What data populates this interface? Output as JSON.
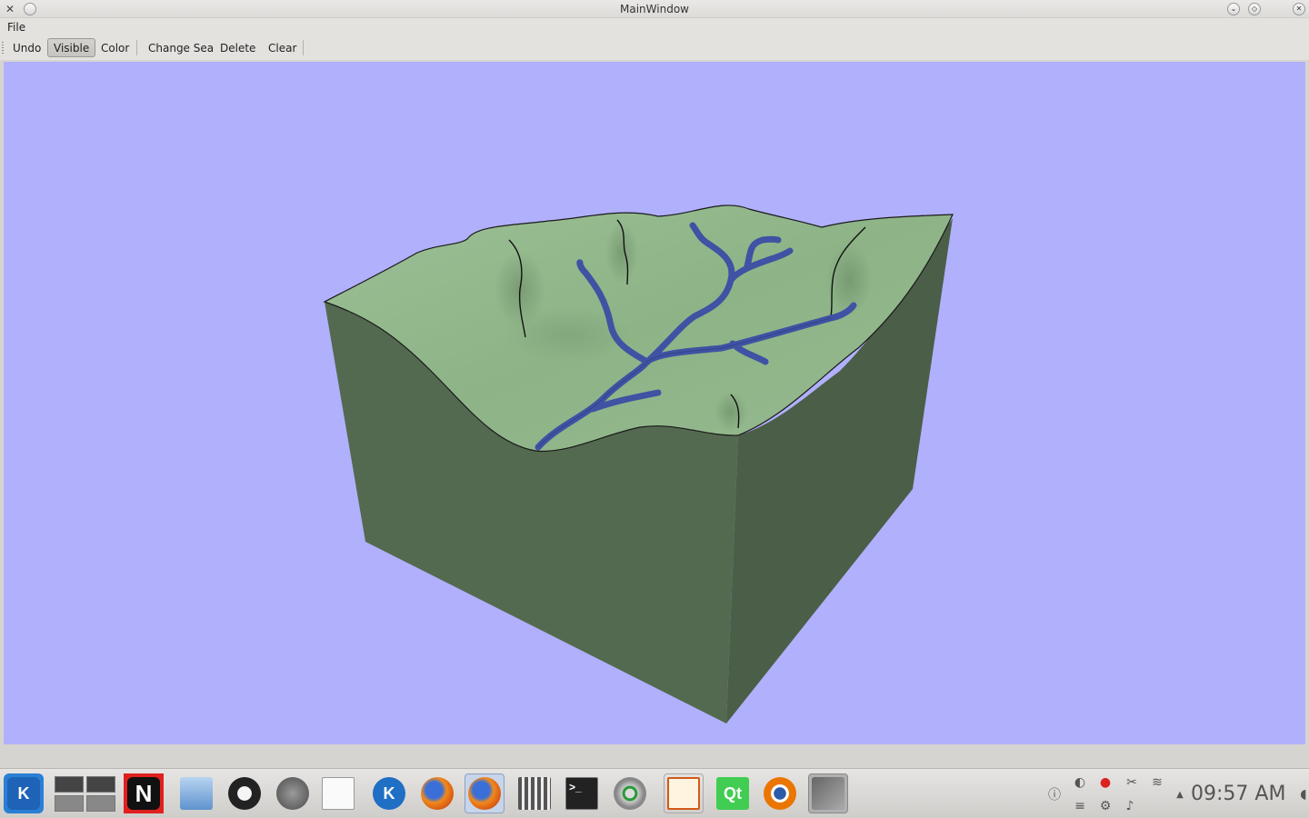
{
  "window": {
    "title": "MainWindow"
  },
  "menubar": {
    "file_label": "File"
  },
  "toolbar": {
    "undo_label": "Undo",
    "visible_label": "Visible",
    "color_label": "Color",
    "change_sea_label": "Change Sea",
    "delete_label": "Delete",
    "clear_label": "Clear"
  },
  "viewport": {
    "background_color": "#b1b0fc",
    "terrain_top_color": "#8fb58a",
    "terrain_side_color": "#536a4f",
    "river_color": "#3f52a3"
  },
  "taskbar": {
    "apps": [
      {
        "icon": "kde-menu-icon",
        "glyph": "K"
      },
      {
        "icon": "pager-icon",
        "glyph": ""
      },
      {
        "icon": "netflix-icon",
        "glyph": "N"
      },
      {
        "icon": "file-manager-icon",
        "glyph": ""
      },
      {
        "icon": "tux-icon",
        "glyph": ""
      },
      {
        "icon": "spotify-icon",
        "glyph": ""
      },
      {
        "icon": "text-editor-icon",
        "glyph": ""
      },
      {
        "icon": "kde-app-icon",
        "glyph": "K"
      },
      {
        "icon": "firefox-icon",
        "glyph": ""
      },
      {
        "icon": "firefox-active-icon",
        "glyph": ""
      },
      {
        "icon": "calculator-icon",
        "glyph": ""
      },
      {
        "icon": "terminal-icon",
        "glyph": ">_"
      },
      {
        "icon": "network-app-icon",
        "glyph": ""
      },
      {
        "icon": "presentation-icon",
        "glyph": ""
      },
      {
        "icon": "qt-creator-icon",
        "glyph": "Qt"
      },
      {
        "icon": "blender-icon",
        "glyph": ""
      },
      {
        "icon": "x-app-icon",
        "glyph": ""
      }
    ],
    "clock": "09:57 AM"
  }
}
